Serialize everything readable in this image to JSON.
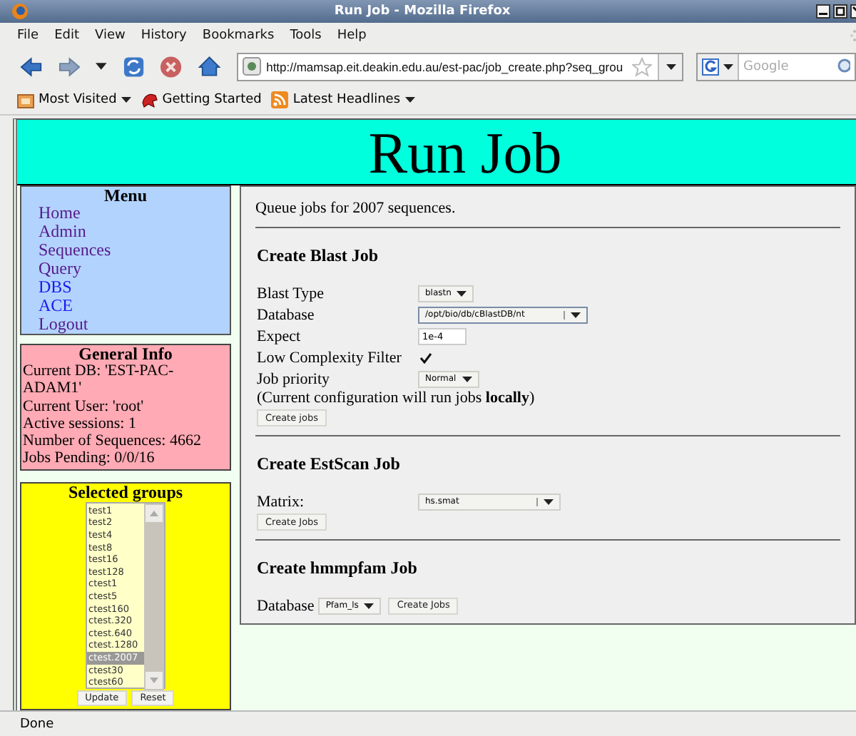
{
  "window": {
    "title": "Run Job - Mozilla Firefox"
  },
  "menu_bar": [
    "File",
    "Edit",
    "View",
    "History",
    "Bookmarks",
    "Tools",
    "Help"
  ],
  "address_bar": {
    "value": "http://mamsap.eit.deakin.edu.au/est-pac/job_create.php?seq_grou"
  },
  "search_field": {
    "placeholder": "Google"
  },
  "bookmarks": [
    {
      "label": "Most Visited",
      "kind": "folder",
      "menu": true
    },
    {
      "label": "Getting Started",
      "kind": "page",
      "menu": false
    },
    {
      "label": "Latest Headlines",
      "kind": "feed",
      "menu": true
    }
  ],
  "page": {
    "heading": "Run Job",
    "menu": {
      "title": "Menu",
      "items": [
        {
          "label": "Home",
          "visited": true
        },
        {
          "label": "Admin",
          "visited": true
        },
        {
          "label": "Sequences",
          "visited": true
        },
        {
          "label": "Query",
          "visited": true
        },
        {
          "label": "DBS",
          "visited": false
        },
        {
          "label": "ACE",
          "visited": false
        },
        {
          "label": "Logout",
          "visited": true
        }
      ]
    },
    "general_info": {
      "title": "General Info",
      "lines": [
        "Current DB: 'EST-PAC-ADAM1'",
        "Current User: 'root'",
        "Active sessions: 1",
        "Number of Sequences: 4662",
        "Jobs Pending: 0/0/16"
      ]
    },
    "selected_groups": {
      "title": "Selected groups",
      "items": [
        {
          "label": "test1",
          "selected": false
        },
        {
          "label": "test2",
          "selected": false
        },
        {
          "label": "test4",
          "selected": false
        },
        {
          "label": "test8",
          "selected": false
        },
        {
          "label": "test16",
          "selected": false
        },
        {
          "label": "test128",
          "selected": false
        },
        {
          "label": "ctest1",
          "selected": false
        },
        {
          "label": "ctest5",
          "selected": false
        },
        {
          "label": "ctest160",
          "selected": false
        },
        {
          "label": "ctest.320",
          "selected": false
        },
        {
          "label": "ctest.640",
          "selected": false
        },
        {
          "label": "ctest.1280",
          "selected": false
        },
        {
          "label": "ctest.2007",
          "selected": true
        },
        {
          "label": "ctest30",
          "selected": false
        },
        {
          "label": "ctest60",
          "selected": false
        }
      ],
      "buttons": [
        "Update",
        "Reset"
      ]
    },
    "main": {
      "intro": "Queue jobs for 2007 sequences.",
      "sections": [
        {
          "title": "Create Blast Job",
          "button_inline": false,
          "fields": [
            {
              "label": "Blast Type",
              "kind": "select",
              "value": "blastn",
              "wide": false
            },
            {
              "label": "Database",
              "kind": "select",
              "value": "/opt/bio/db/cBlastDB/nt",
              "wide": true,
              "focused": true
            },
            {
              "label": "Expect",
              "kind": "text",
              "value": "1e-4"
            },
            {
              "label": "Low Complexity Filter",
              "kind": "checkbox",
              "checked": true
            },
            {
              "label": "Job priority",
              "kind": "select",
              "value": "Normal",
              "wide": false
            }
          ],
          "note": "(Current configuration will run jobs **locally**)",
          "button": "Create jobs"
        },
        {
          "title": "Create EstScan Job",
          "button_inline": false,
          "fields": [
            {
              "label": "Matrix:",
              "kind": "select",
              "value": "hs.smat",
              "wide": true
            }
          ],
          "button": "Create Jobs"
        },
        {
          "title": "Create hmmpfam Job",
          "button_inline": true,
          "fields": [
            {
              "label": "Database",
              "kind": "select",
              "value": "Pfam_ls",
              "wide": false
            }
          ],
          "button": "Create Jobs"
        }
      ]
    }
  },
  "status_bar": "Done"
}
